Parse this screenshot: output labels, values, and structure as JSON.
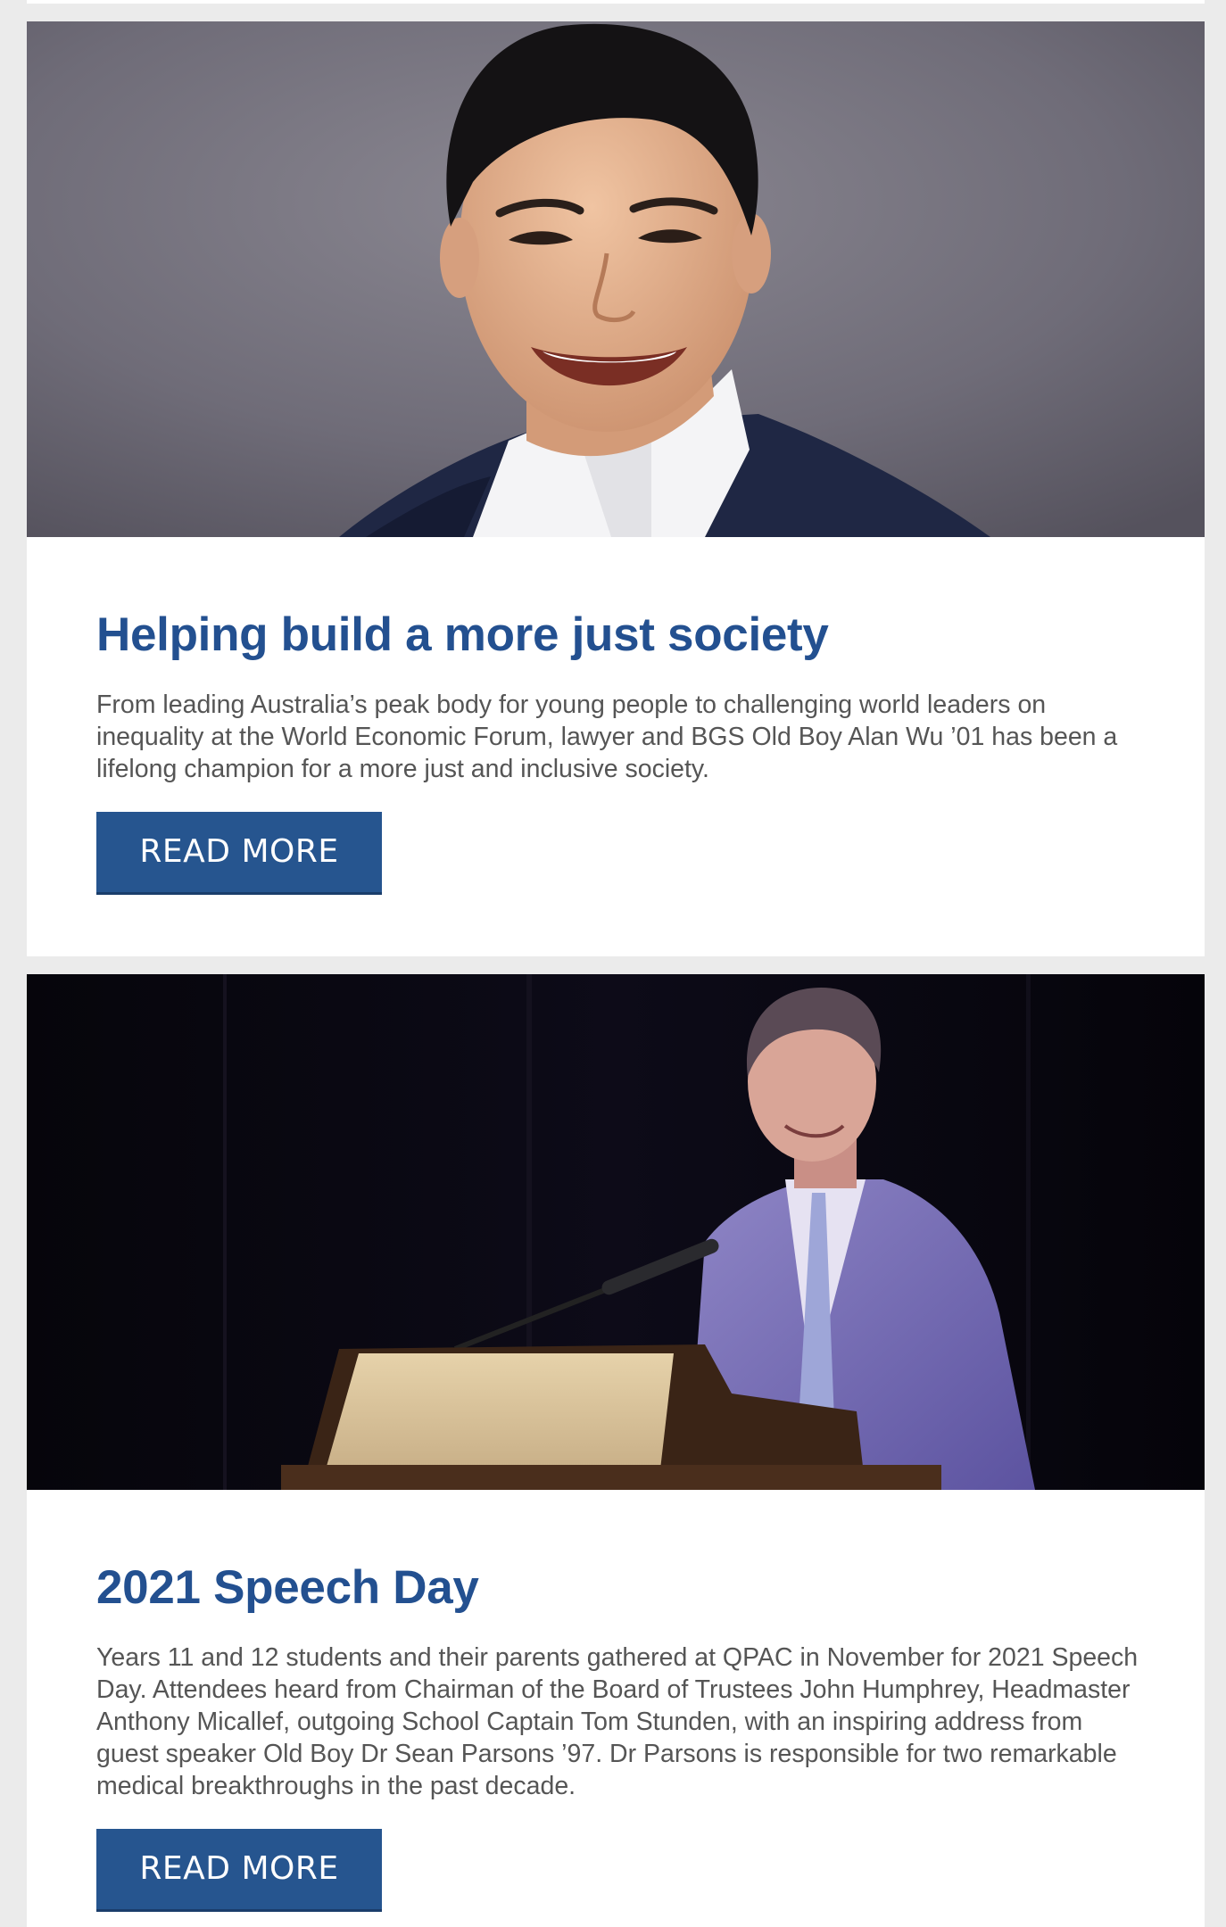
{
  "articles": [
    {
      "image_alt": "Portrait of a smiling man in a navy suit with white open-collar shirt against grey backdrop",
      "title": "Helping build a more just society",
      "body": "From leading Australia’s peak body for young people to challenging world leaders on inequality at the World Economic Forum, lawyer and BGS Old Boy Alan Wu ’01 has been a lifelong champion for a more just and inclusive society.",
      "button_label": "READ MORE"
    },
    {
      "image_alt": "Man in grey suit speaking at a wooden lectern with microphone on a dark stage",
      "title": "2021 Speech Day",
      "body": "Years 11 and 12 students and their parents gathered at QPAC in November for 2021 Speech Day. Attendees heard from Chairman of the Board of Trustees John Humphrey, Headmaster Anthony Micallef, outgoing School Captain Tom Stunden, with an inspiring address from guest speaker Old Boy Dr Sean Parsons ’97. Dr Parsons is responsible for two remarkable medical breakthroughs in the past decade.",
      "button_label": "READ MORE"
    }
  ],
  "colors": {
    "page_background": "#ebebeb",
    "card_background": "#ffffff",
    "title": "#235090",
    "body_text": "#555555",
    "button": "#26558f",
    "button_text": "#ffffff"
  }
}
